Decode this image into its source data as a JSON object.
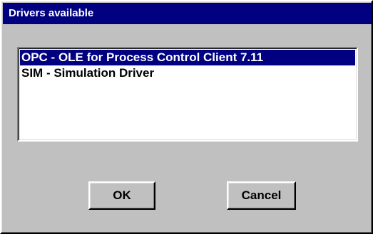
{
  "window": {
    "title": "Drivers available"
  },
  "drivers_list": {
    "items": [
      {
        "label": "OPC - OLE for Process Control Client  7.11",
        "selected": true
      },
      {
        "label": "SIM - Simulation Driver",
        "selected": false
      }
    ]
  },
  "buttons": {
    "ok_label": "OK",
    "cancel_label": "Cancel"
  },
  "colors": {
    "titlebar": "#000080",
    "selection": "#000080",
    "face": "#c0c0c0"
  }
}
